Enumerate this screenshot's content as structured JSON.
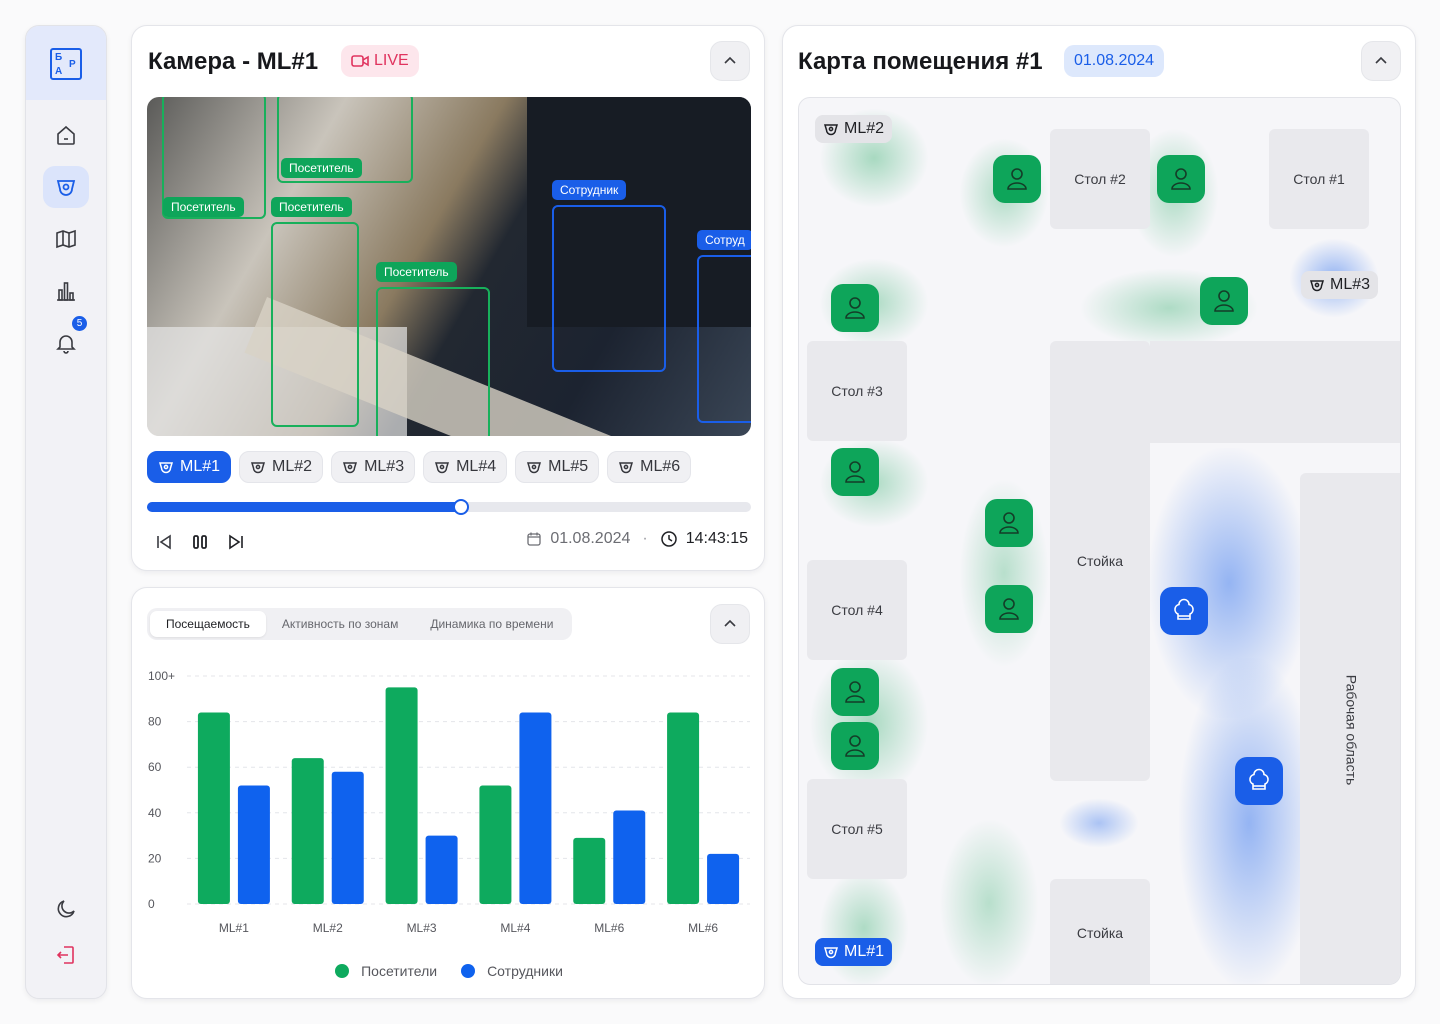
{
  "sidebar": {
    "logo_letters": [
      "Б",
      "Р",
      "А"
    ],
    "badge_count": "5",
    "items": [
      {
        "icon": "home-icon"
      },
      {
        "icon": "camera-icon"
      },
      {
        "icon": "map-icon"
      },
      {
        "icon": "chart-icon"
      },
      {
        "icon": "bell-icon"
      }
    ]
  },
  "camera_panel": {
    "title": "Камера - ML#1",
    "live_label": "LIVE",
    "detections": [
      {
        "label": "Посетитель",
        "kind": "visitor"
      },
      {
        "label": "Посетитель",
        "kind": "visitor"
      },
      {
        "label": "Посетитель",
        "kind": "visitor"
      },
      {
        "label": "Посетитель",
        "kind": "visitor"
      },
      {
        "label": "Сотрудник",
        "kind": "staff"
      },
      {
        "label": "Сотруд",
        "kind": "staff"
      }
    ],
    "cameras": [
      "ML#1",
      "ML#2",
      "ML#3",
      "ML#4",
      "ML#5",
      "ML#6"
    ],
    "active_camera": "ML#1",
    "progress": 0.52,
    "date": "01.08.2024",
    "separator": "·",
    "time": "14:43:15"
  },
  "stats_panel": {
    "tabs": [
      "Посещаемость",
      "Активность по зонам",
      "Динамика по времени"
    ],
    "active_tab": "Посещаемость",
    "legend": [
      "Посетители",
      "Сотрудники"
    ]
  },
  "chart_data": {
    "type": "bar",
    "categories": [
      "ML#1",
      "ML#2",
      "ML#3",
      "ML#4",
      "ML#6",
      "ML#6"
    ],
    "series": [
      {
        "name": "Посетители",
        "color": "#0eaa5e",
        "values": [
          84,
          64,
          95,
          52,
          29,
          84
        ]
      },
      {
        "name": "Сотрудники",
        "color": "#0f62ee",
        "values": [
          52,
          58,
          30,
          84,
          41,
          22
        ]
      }
    ],
    "yticks": [
      "100+",
      "80",
      "60",
      "40",
      "20",
      "0"
    ],
    "ylim": [
      0,
      100
    ],
    "grid": true,
    "legend_position": "bottom"
  },
  "map_panel": {
    "title": "Карта помещения #1",
    "date": "01.08.2024",
    "zones": [
      "Стол #2",
      "Стол #1",
      "Стол #3",
      "Стол #4",
      "Стол #5",
      "Стойка",
      "Стойка",
      "Рабочая область"
    ],
    "cameras": [
      "ML#2",
      "ML#3",
      "ML#1"
    ],
    "colors": {
      "visitor": "#0ea55a",
      "staff": "#1a5ee8"
    }
  }
}
